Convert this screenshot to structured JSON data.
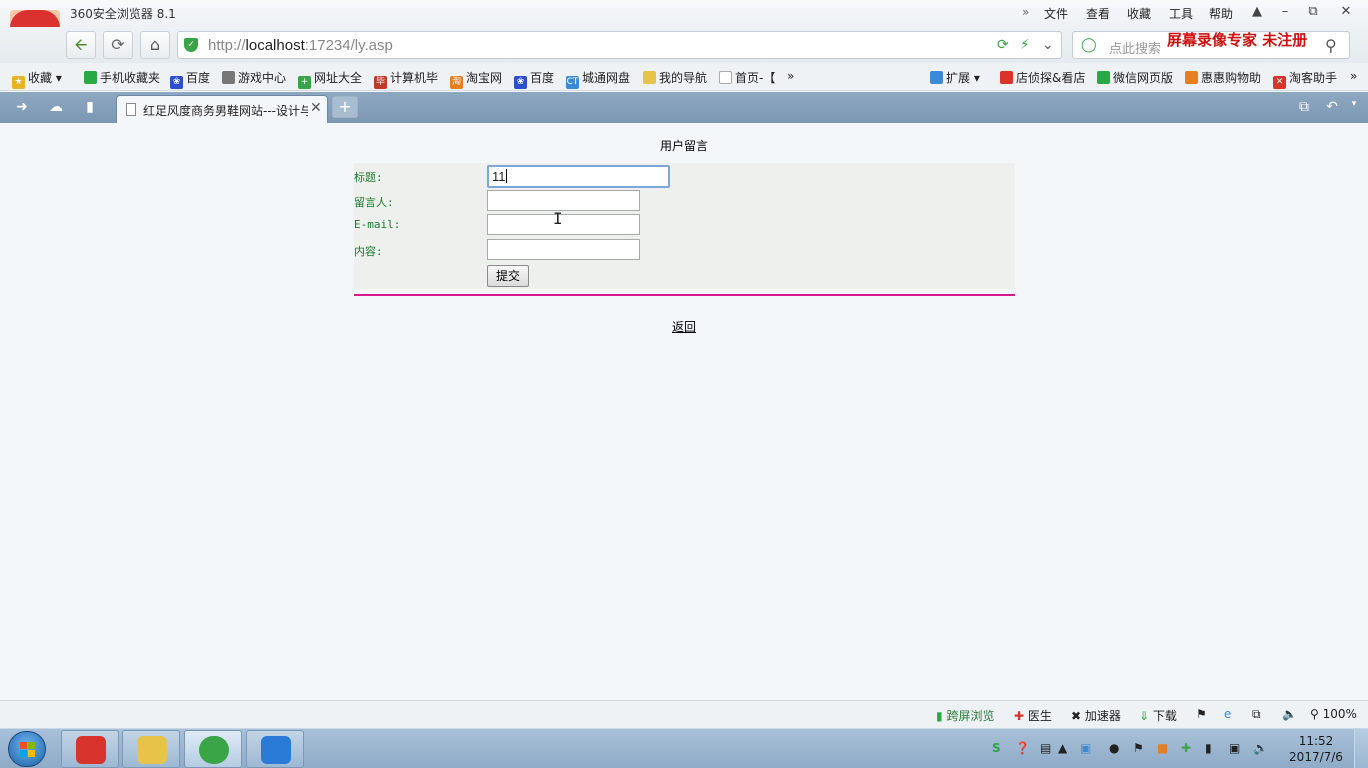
{
  "browser": {
    "app_title": "360安全浏览器 8.1",
    "menu": [
      "文件",
      "查看",
      "收藏",
      "工具",
      "帮助"
    ],
    "more_glyph": "»",
    "url_prefix": "http://",
    "url_host": "localhost",
    "url_rest": ":17234/ly.asp",
    "search_placeholder": "点此搜索",
    "watermark": "屏幕录像专家  未注册"
  },
  "bookmarks": [
    {
      "label": "收藏",
      "color": "#e6b422"
    },
    {
      "label": "手机收藏夹",
      "color": "#2aa845"
    },
    {
      "label": "百度",
      "color": "#2b50c8"
    },
    {
      "label": "游戏中心",
      "color": "#777777"
    },
    {
      "label": "网址大全",
      "color": "#3aa546"
    },
    {
      "label": "计算机毕",
      "color": "#c0392b"
    },
    {
      "label": "淘宝网",
      "color": "#e67e22"
    },
    {
      "label": "百度",
      "color": "#2b50c8"
    },
    {
      "label": "城通网盘",
      "color": "#3a8ad8"
    },
    {
      "label": "我的导航",
      "color": "#e8c34a"
    },
    {
      "label": "首页-【",
      "color": "#aaaaaa"
    }
  ],
  "bookmarks_right": [
    {
      "label": "扩展",
      "color": "#3a8ad8"
    },
    {
      "label": "店侦探&看店",
      "color": "#d9342b"
    },
    {
      "label": "微信网页版",
      "color": "#2aa845"
    },
    {
      "label": "惠惠购物助",
      "color": "#e67e22"
    },
    {
      "label": "淘客助手",
      "color": "#d9342b"
    }
  ],
  "tab": {
    "title": "红足风度商务男鞋网站---设计与实现",
    "close": "✕",
    "new": "+"
  },
  "page": {
    "heading": "用户留言",
    "fields": {
      "title_label": "标题:",
      "title_value": "11",
      "author_label": "留言人:",
      "author_value": "",
      "email_label": "E-mail:",
      "email_value": "",
      "content_label": "内容:",
      "content_value": ""
    },
    "submit_label": "提交",
    "back_label": "返回"
  },
  "statusbar": {
    "items": [
      "跨屏浏览",
      "医生",
      "加速器",
      "下载"
    ],
    "zoom": "100%"
  },
  "taskbar": {
    "time": "11:52",
    "date": "2017/7/6"
  }
}
